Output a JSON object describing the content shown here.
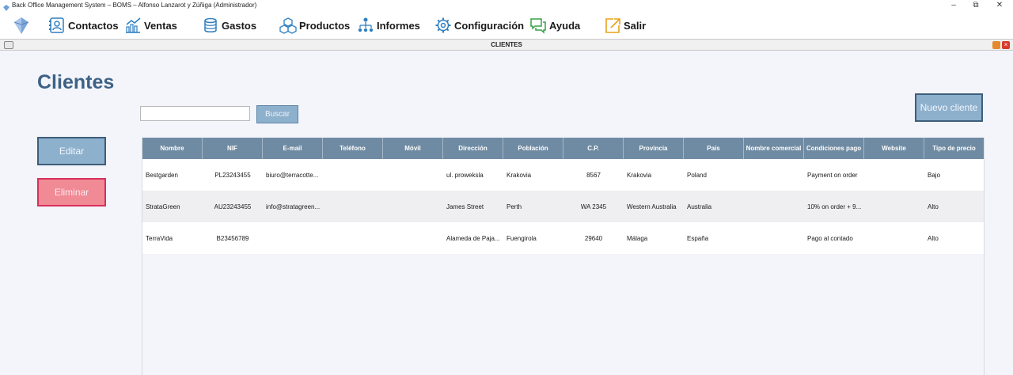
{
  "window": {
    "title": "Back Office Management System – BOMS – Alfonso Lanzarot y Zúñiga (Administrador)",
    "controls": {
      "minimize": "–",
      "restore": "⧉",
      "close": "✕"
    }
  },
  "menu": [
    {
      "key": "contactos",
      "label": "Contactos",
      "icon": "contacts-icon"
    },
    {
      "key": "ventas",
      "label": "Ventas",
      "icon": "sales-chart-icon"
    },
    {
      "key": "gastos",
      "label": "Gastos",
      "icon": "coins-icon"
    },
    {
      "key": "productos",
      "label": "Productos",
      "icon": "boxes-icon"
    },
    {
      "key": "informes",
      "label": "Informes",
      "icon": "hierarchy-icon"
    },
    {
      "key": "configuracion",
      "label": "Configuración",
      "icon": "gear-icon"
    },
    {
      "key": "ayuda",
      "label": "Ayuda",
      "icon": "chat-bubbles-icon"
    },
    {
      "key": "salir",
      "label": "Salir",
      "icon": "exit-arrow-icon"
    }
  ],
  "frame": {
    "title": "CLIENTES"
  },
  "page": {
    "title": "Clientes",
    "search_value": "",
    "search_button": "Buscar",
    "new_button": "Nuevo cliente",
    "edit_button": "Editar",
    "delete_button": "Eliminar"
  },
  "table": {
    "columns": [
      "Nombre",
      "NIF",
      "E-mail",
      "Teléfono",
      "Móvil",
      "Dirección",
      "Población",
      "C.P.",
      "Provincia",
      "País",
      "Nombre comercial",
      "Condiciones pago",
      "Website",
      "Tipo de precio"
    ],
    "rows": [
      [
        "Bestgarden",
        "PL23243455",
        "biuro@terracotte...",
        "",
        "",
        "ul. proweksla",
        "Krakovia",
        "8567",
        "Krakovia",
        "Poland",
        "",
        "Payment on order",
        "",
        "Bajo"
      ],
      [
        "StrataGreen",
        "AU23243455",
        "info@stratagreen...",
        "",
        "",
        "James Street",
        "Perth",
        "WA 2345",
        "Western Australia",
        "Australia",
        "",
        "10% on order + 9...",
        "",
        "Alto"
      ],
      [
        "TerraVida",
        "B23456789",
        "",
        "",
        "",
        "Alameda de Paja...",
        "Fuengirola",
        "29640",
        "Málaga",
        "España",
        "",
        "Pago al contado",
        "",
        "Alto"
      ]
    ]
  },
  "colors": {
    "title_blue": "#3d6287",
    "button_blue": "#8db0cd",
    "button_border": "#3d5e7c",
    "delete_fill": "#f08a95",
    "delete_border": "#d8305c",
    "header_bg": "#6f8ba3"
  }
}
